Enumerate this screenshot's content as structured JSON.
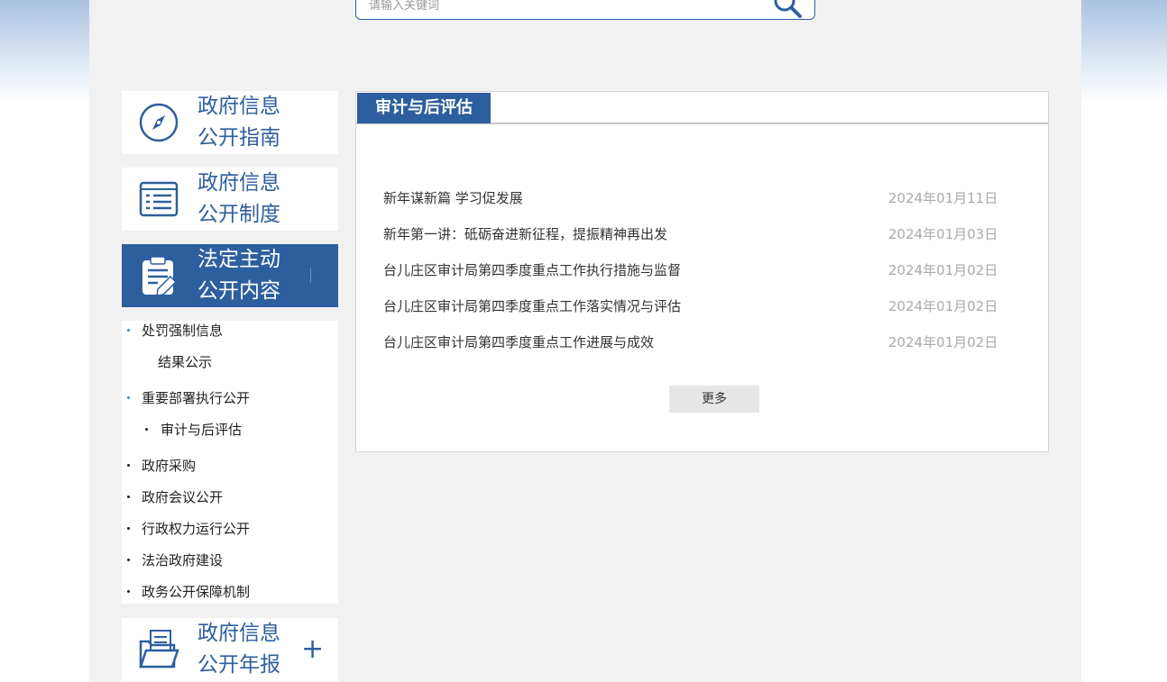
{
  "search": {
    "placeholder": "请输入关键词"
  },
  "nav": {
    "guide": {
      "line1": "政府信息",
      "line2": "公开指南"
    },
    "system": {
      "line1": "政府信息",
      "line2": "公开制度"
    },
    "statutory": {
      "line1": "法定主动",
      "line2": "公开内容"
    },
    "annual": {
      "line1": "政府信息",
      "line2": "公开年报",
      "expand": "+"
    }
  },
  "subnav": {
    "items": [
      {
        "label": "处罚强制信息"
      },
      {
        "label": "结果公示"
      },
      {
        "label": "重要部署执行公开"
      },
      {
        "label": "审计与后评估"
      },
      {
        "label": "政府采购"
      },
      {
        "label": "政府会议公开"
      },
      {
        "label": "行政权力运行公开"
      },
      {
        "label": "法治政府建设"
      },
      {
        "label": "政务公开保障机制"
      }
    ]
  },
  "panel": {
    "tab_title": "审计与后评估",
    "news": [
      {
        "title": "新年谋新篇 学习促发展",
        "date": "2024年01月11日"
      },
      {
        "title": "新年第一讲：砥砺奋进新征程，提振精神再出发",
        "date": "2024年01月03日"
      },
      {
        "title": "台儿庄区审计局第四季度重点工作执行措施与监督",
        "date": "2024年01月02日"
      },
      {
        "title": "台儿庄区审计局第四季度重点工作落实情况与评估",
        "date": "2024年01月02日"
      },
      {
        "title": "台儿庄区审计局第四季度重点工作进展与成效",
        "date": "2024年01月02日"
      }
    ],
    "more_label": "更多"
  },
  "colors": {
    "brand": "#2d5f9e",
    "background": "#f1f1f1",
    "date": "#aaaaaa"
  }
}
